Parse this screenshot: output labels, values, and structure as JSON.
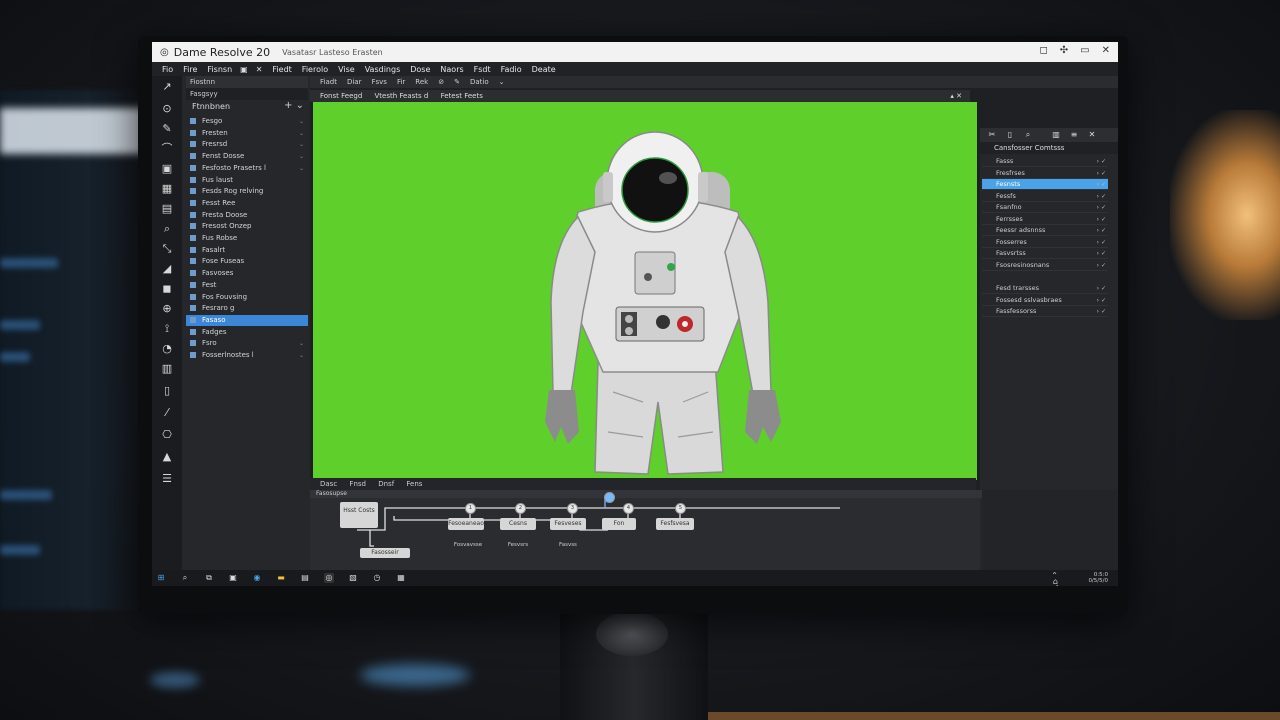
{
  "app": {
    "title": "Dame Resolve 20",
    "subtitle": "Vasatasr  Lasteso  Erasten"
  },
  "window_controls": [
    "◻",
    "✣",
    "▭",
    "✕"
  ],
  "menubar": [
    "Fio",
    "Fire",
    "Fisnsn"
  ],
  "menubar_icons": [
    "▣",
    "✕"
  ],
  "page_tabs": [
    "Fiedt",
    "Fierolo",
    "Vise",
    "Vasdings",
    "Dose",
    "Naors",
    "Fsdt",
    "Fadio",
    "Deate"
  ],
  "toolbar_row2": [
    "Fiadt",
    "Diar",
    "Fsvs",
    "Fir",
    "Rek"
  ],
  "toolbar_row2_tail": [
    "Datio"
  ],
  "effects_panel": {
    "header": "Fiostnn",
    "category": "Fasgsyy",
    "title": "Ftnnbnen",
    "items": [
      {
        "label": "Fesgo",
        "selected": false
      },
      {
        "label": "Fresten",
        "selected": false
      },
      {
        "label": "Fresrsd",
        "selected": false
      },
      {
        "label": "Fenst Dosse",
        "selected": false
      },
      {
        "label": "Fesfosto Prasetrs l",
        "selected": false
      },
      {
        "label": "Fus laust",
        "selected": false
      },
      {
        "label": "Fesds Rog relving",
        "selected": false
      },
      {
        "label": "Fesst Ree",
        "selected": false
      },
      {
        "label": "Fresta Doose",
        "selected": false
      },
      {
        "label": "Fresost Onzep",
        "selected": false
      },
      {
        "label": "Fus Robse",
        "selected": false
      },
      {
        "label": "Fasalrt",
        "selected": false
      },
      {
        "label": "Fose Fuseas",
        "selected": false
      },
      {
        "label": "Fasvoses",
        "selected": false
      },
      {
        "label": "Fest",
        "selected": false
      },
      {
        "label": "Fos Fouvsing",
        "selected": false
      },
      {
        "label": "Fesraro g",
        "selected": false
      },
      {
        "label": "Fasaso",
        "selected": true
      },
      {
        "label": "Fadges",
        "selected": false
      },
      {
        "label": "Fsro",
        "selected": false
      },
      {
        "label": "Fosserlnostes l",
        "selected": false
      }
    ]
  },
  "viewer": {
    "header": [
      "Fonst Feegd",
      "Vtesth Feasts d",
      "Fetest Feets"
    ],
    "controls": [
      "Dasc",
      "Fnsd",
      "Dnsf",
      "Fens"
    ],
    "backdrop_color": "#5fcf2b"
  },
  "inspector": {
    "title": "Cansfosser Comtsss",
    "rows": [
      {
        "label": "Fasss",
        "selected": false
      },
      {
        "label": "Fresfrses",
        "selected": false
      },
      {
        "label": "Fesnsts",
        "selected": true
      },
      {
        "label": "Fessfs",
        "selected": false
      },
      {
        "label": "Fsanfno",
        "selected": false
      },
      {
        "label": "Ferrsses",
        "selected": false
      },
      {
        "label": "Feessr adsnnss",
        "selected": false
      },
      {
        "label": "Fosserres",
        "selected": false
      },
      {
        "label": "Fasvsrtss",
        "selected": false
      },
      {
        "label": "Fsosresinosnans",
        "selected": false
      },
      {
        "label": "Fesd trarsses",
        "selected": false
      },
      {
        "label": "Fossesd sslvasbraes",
        "selected": false
      },
      {
        "label": "Fassfessorss",
        "selected": false
      }
    ]
  },
  "node_editor": {
    "header": "Fasosupse",
    "source_node": "Hsst Costs",
    "source_sub": "Fasosseir",
    "nodes": [
      {
        "label": "Fesoeaneao",
        "caption": "Fosvavsse"
      },
      {
        "label": "Cesns",
        "caption": "Fesvsrs"
      },
      {
        "label": "Fesveses",
        "caption": "Fasvss"
      },
      {
        "label": "Fon",
        "caption": ""
      },
      {
        "label": "Fesfsvesa",
        "caption": ""
      }
    ]
  },
  "taskbar": {
    "tray_time": "0:5:0",
    "tray_date": "0/5/5/0"
  },
  "colors": {
    "accent": "#3c86d8",
    "green_screen": "#5fcf2b"
  }
}
